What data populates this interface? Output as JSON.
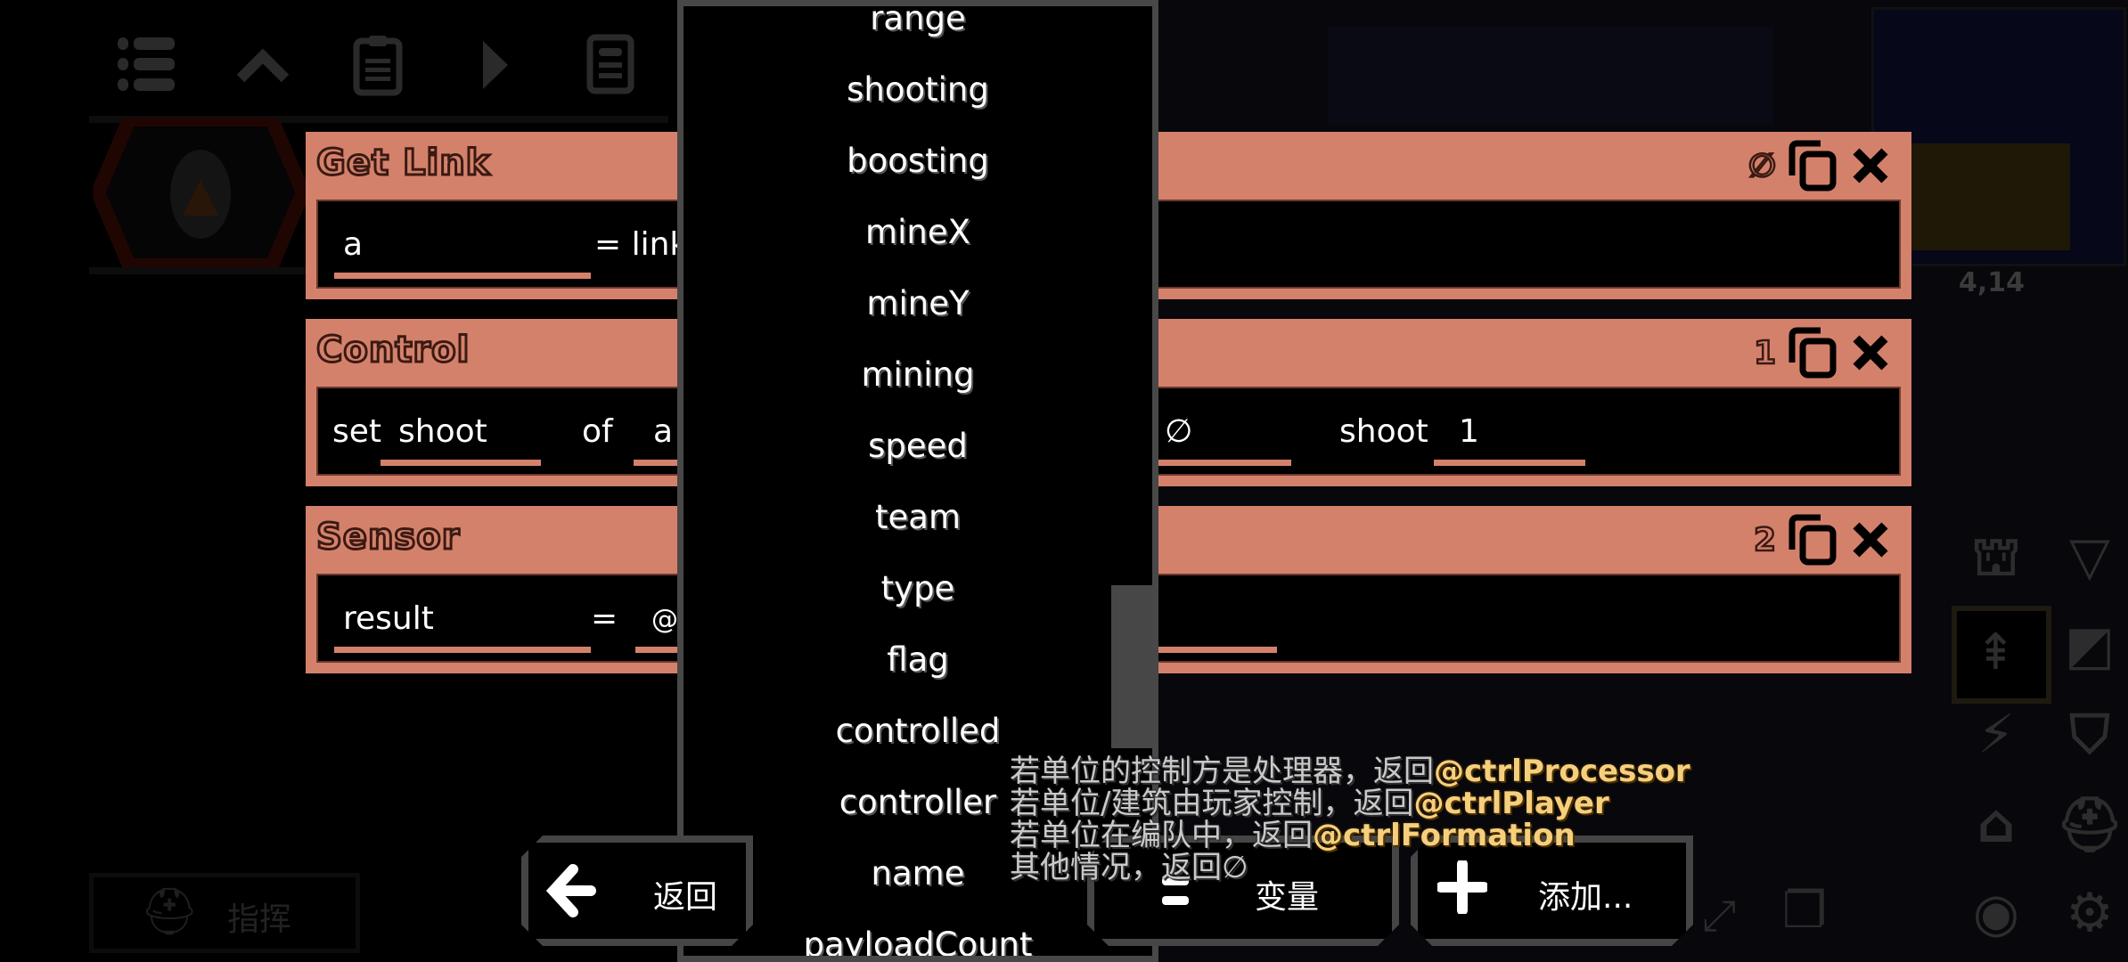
{
  "toolbar": {
    "icons": [
      "list-icon",
      "chevron-up-icon",
      "clipboard-icon",
      "play-icon",
      "document-icon"
    ]
  },
  "blocks": [
    {
      "title": "Get Link",
      "index": "∅",
      "fields": {
        "var": "a",
        "op": "= link"
      }
    },
    {
      "title": "Control",
      "index": "1",
      "fields": {
        "set": "set",
        "prop": "shoot",
        "of": "of",
        "unit": "a",
        "x_val": "∅",
        "shoot_label": "shoot",
        "shoot_val": "1"
      }
    },
    {
      "title": "Sensor",
      "index": "2",
      "fields": {
        "result": "result",
        "eq": "=",
        "sensor": "@c"
      }
    }
  ],
  "dropdown": {
    "items": [
      "range",
      "shooting",
      "boosting",
      "mineX",
      "mineY",
      "mining",
      "speed",
      "team",
      "type",
      "flag",
      "controlled",
      "controller",
      "name",
      "payloadCount"
    ]
  },
  "tooltip": {
    "lines": [
      {
        "text": "若单位的控制方是处理器，返回",
        "value": "@ctrlProcessor"
      },
      {
        "text": "若单位/建筑由玩家控制，返回",
        "value": "@ctrlPlayer"
      },
      {
        "text": "若单位在编队中，返回",
        "value": "@ctrlFormation"
      },
      {
        "text": "其他情况，返回",
        "value": "∅"
      }
    ]
  },
  "bottom": {
    "back_label": "返回",
    "variables_label": "变量",
    "add_label": "添加...",
    "command_label": "指挥"
  },
  "hud": {
    "coords": "4,14"
  },
  "colors": {
    "block": "#d4816c",
    "highlight": "#f6cf7e",
    "scrollbar": "#474747"
  }
}
